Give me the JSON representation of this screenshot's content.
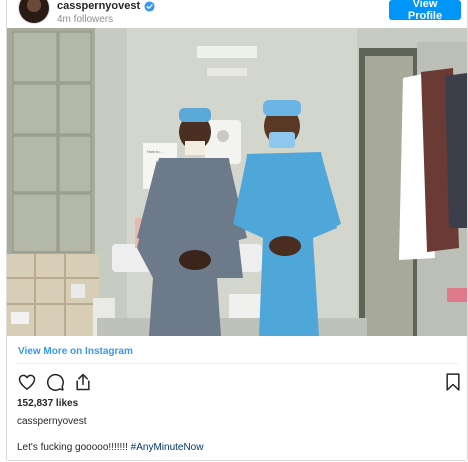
{
  "header": {
    "username": "casspernyovest",
    "followers": "4m followers",
    "view_profile_label": "View Profile"
  },
  "photo": {
    "alt": "",
    "sign_text": "How to..."
  },
  "view_more_label": "View More on Instagram",
  "likes": "152,837 likes",
  "caption_username": "casspernyovest",
  "caption": {
    "text": "Let's fucking gooooo!!!!!!! ",
    "hashtag": "#AnyMinuteNow"
  },
  "icons": {
    "like": "heart-icon",
    "comment": "comment-icon",
    "share": "share-icon",
    "save": "bookmark-icon",
    "verified": "verified-badge-icon"
  },
  "colors": {
    "accent": "#0095f6",
    "link": "#3897f0",
    "verified": "#3897f0"
  }
}
